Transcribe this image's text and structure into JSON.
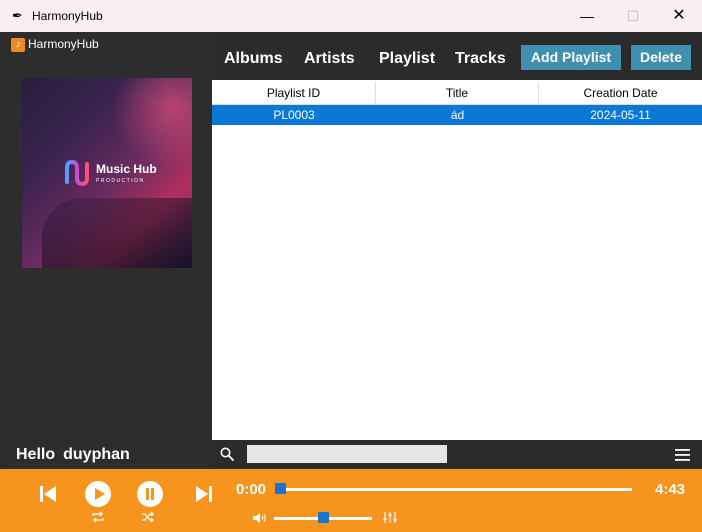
{
  "window": {
    "title": "HarmonyHub",
    "minimize_glyph": "—",
    "maximize_glyph": "☐",
    "close_glyph": "✕"
  },
  "sidebar": {
    "brand_label": "HarmonyHub",
    "cover": {
      "logo_text": "Music Hub",
      "logo_subtext": "PRODUCTION"
    },
    "greeting": "Hello",
    "username": "duyphan"
  },
  "nav": {
    "tabs": [
      {
        "label": "Albums"
      },
      {
        "label": "Artists"
      },
      {
        "label": "Playlist"
      },
      {
        "label": "Tracks"
      }
    ],
    "add_playlist_label": "Add Playlist",
    "delete_label": "Delete"
  },
  "table": {
    "columns": [
      "Playlist ID",
      "Title",
      "Creation Date"
    ],
    "rows": [
      {
        "id": "PL0003",
        "title": "ád",
        "date": "2024-05-11",
        "selected": true
      }
    ]
  },
  "search": {
    "value": "",
    "placeholder": ""
  },
  "player": {
    "current_time": "0:00",
    "total_time": "4:43",
    "progress": 0.0,
    "volume": 0.5
  },
  "colors": {
    "accent": "#f7941d",
    "button": "#3f8fae",
    "selection": "#0a78d7",
    "knob": "#1a73d0"
  }
}
